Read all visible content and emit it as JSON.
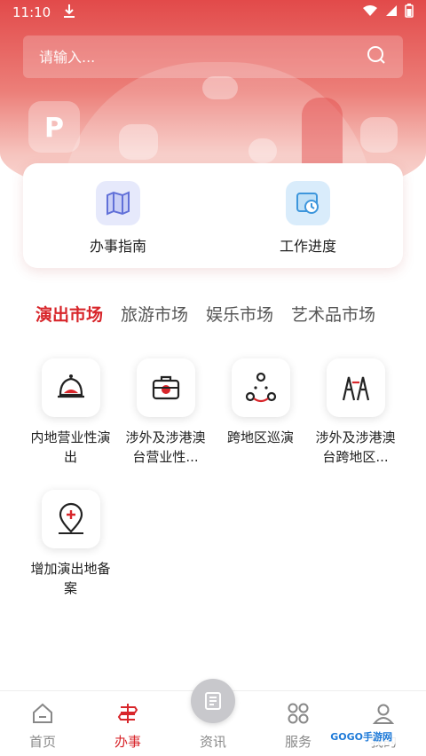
{
  "status_bar": {
    "time": "11:10"
  },
  "search": {
    "placeholder": "请输入..."
  },
  "quick_actions": [
    {
      "label": "办事指南",
      "icon": "map-icon"
    },
    {
      "label": "工作进度",
      "icon": "progress-clock-icon"
    }
  ],
  "tabs": [
    {
      "label": "演出市场",
      "active": true
    },
    {
      "label": "旅游市场",
      "active": false
    },
    {
      "label": "娱乐市场",
      "active": false
    },
    {
      "label": "艺术品市场",
      "active": false
    }
  ],
  "services": [
    {
      "label": "内地营业性演出",
      "icon": "bell-hat-icon"
    },
    {
      "label": "涉外及涉港澳台营业性...",
      "icon": "briefcase-icon"
    },
    {
      "label": "跨地区巡演",
      "icon": "route-icon"
    },
    {
      "label": "涉外及涉港澳台跨地区...",
      "icon": "performers-icon"
    },
    {
      "label": "增加演出地备案",
      "icon": "location-add-icon"
    }
  ],
  "bottom_nav": [
    {
      "label": "首页",
      "icon": "home-icon"
    },
    {
      "label": "办事",
      "icon": "signpost-icon",
      "active": true
    },
    {
      "label": "资讯",
      "icon": "news-icon"
    },
    {
      "label": "服务",
      "icon": "grid-icon"
    },
    {
      "label": "我的",
      "icon": "user-icon"
    }
  ],
  "watermark": "GOGO手游网",
  "colors": {
    "accent": "#d8262b",
    "hero_top": "#e24a4a"
  }
}
